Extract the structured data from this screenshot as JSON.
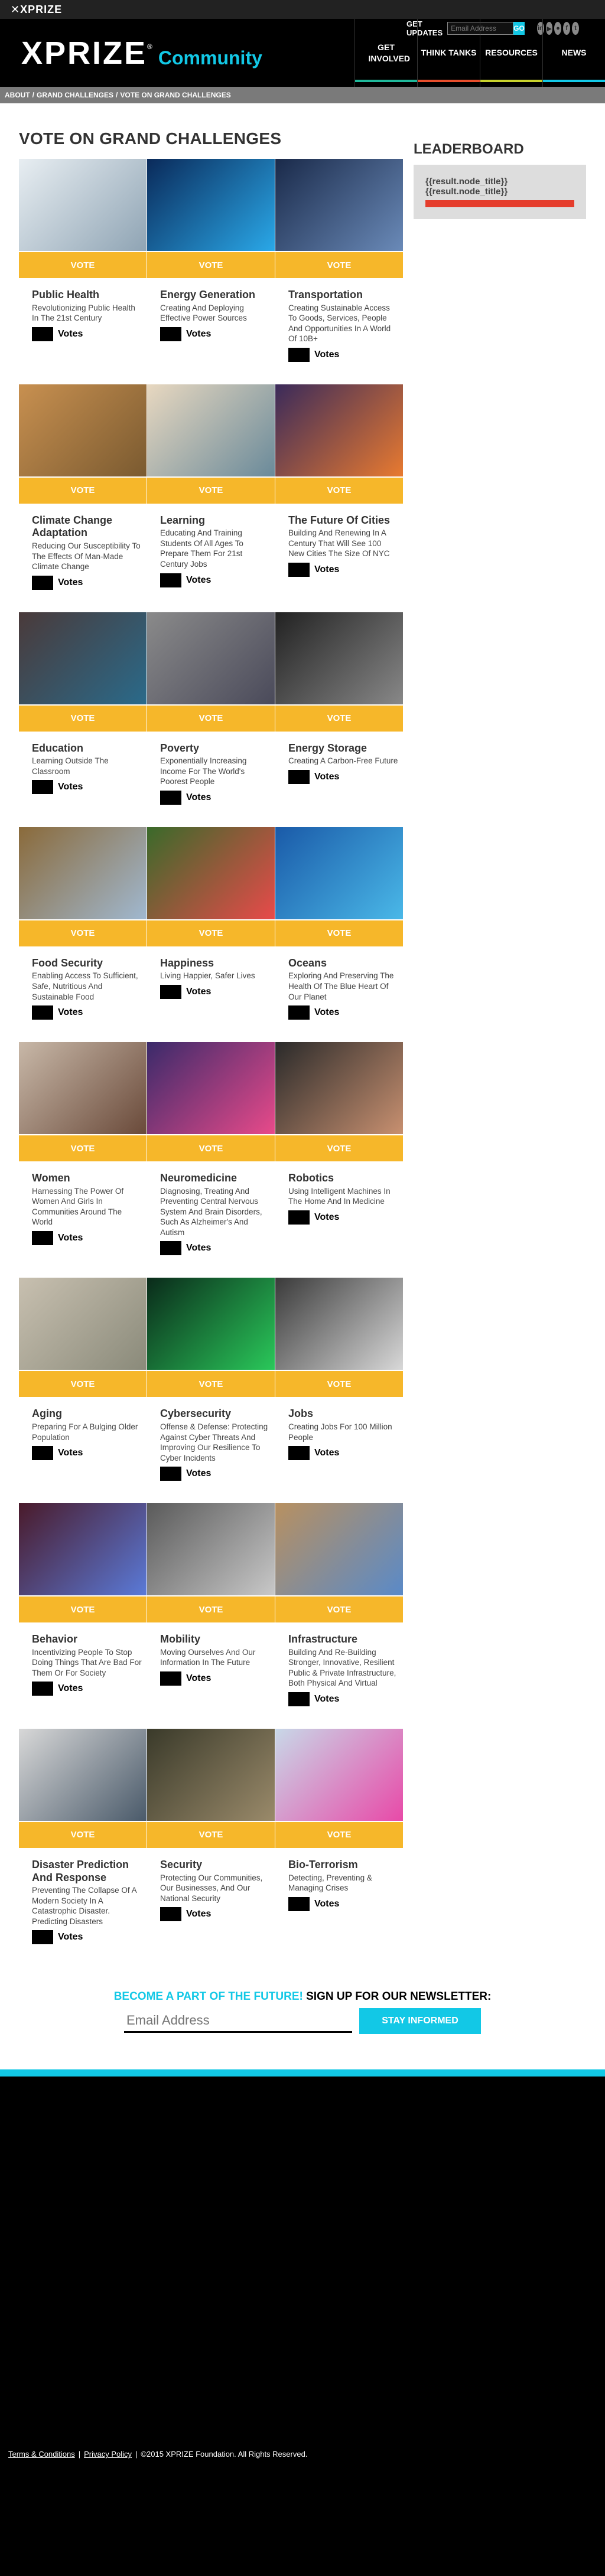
{
  "topbar": {
    "brand": "XPRIZE",
    "updates_label": "GET UPDATES",
    "email_placeholder": "Email Address",
    "go_label": "GO",
    "social": [
      "in",
      "▶",
      "●",
      "f",
      "t"
    ]
  },
  "header": {
    "logo": "XPRIZE",
    "tm": "®",
    "community": "Community",
    "nav": [
      "GET INVOLVED",
      "THINK TANKS",
      "RESOURCES",
      "NEWS"
    ]
  },
  "breadcrumb": [
    "ABOUT",
    "/",
    "GRAND CHALLENGES",
    "/",
    "VOTE ON GRAND CHALLENGES"
  ],
  "page_title": "VOTE ON GRAND CHALLENGES",
  "vote_label": "VOTE",
  "votes_label": "Votes",
  "challenges": [
    {
      "title": "Public Health",
      "desc": "revolutionizing public health in the 21st century"
    },
    {
      "title": "Energy Generation",
      "desc": "creating and deploying effective power sources"
    },
    {
      "title": "Transportation",
      "desc": "creating sustainable access to goods, services, people and opportunities in a world of 10B+"
    },
    {
      "title": "Climate Change Adaptation",
      "desc": "reducing our susceptibility to the effects of man-made climate change"
    },
    {
      "title": "Learning",
      "desc": "educating and training students of all ages to prepare them for 21st century jobs"
    },
    {
      "title": "The Future Of Cities",
      "desc": "building and renewing in a century that will see 100 new cities the size of NYC"
    },
    {
      "title": "Education",
      "desc": "Learning outside the classroom"
    },
    {
      "title": "Poverty",
      "desc": "exponentially increasing income for the world's poorest people"
    },
    {
      "title": "Energy Storage",
      "desc": "creating a carbon-free future"
    },
    {
      "title": "Food Security",
      "desc": "enabling access to sufficient, safe, nutritious and sustainable food"
    },
    {
      "title": "Happiness",
      "desc": "Living happier, safer lives"
    },
    {
      "title": "Oceans",
      "desc": "exploring and preserving the health of the blue heart of our planet"
    },
    {
      "title": "Women",
      "desc": "harnessing the power of women and girls in communities around the world"
    },
    {
      "title": "Neuromedicine",
      "desc": "Diagnosing, treating and preventing central nervous system and brain disorders, such as Alzheimer's and Autism"
    },
    {
      "title": "Robotics",
      "desc": "using intelligent machines in the home and in medicine"
    },
    {
      "title": "Aging",
      "desc": "preparing for a bulging older population"
    },
    {
      "title": "Cybersecurity",
      "desc": "offense & defense: protecting against cyber threats and improving our resilience to cyber incidents"
    },
    {
      "title": "Jobs",
      "desc": "creating jobs for 100 million people"
    },
    {
      "title": "Behavior",
      "desc": "incentivizing people to stop doing things that are bad for them or for society"
    },
    {
      "title": "Mobility",
      "desc": "moving ourselves and our information in the future"
    },
    {
      "title": "Infrastructure",
      "desc": "building and re-building stronger, innovative, resilient public & private infrastructure, both physical and virtual"
    },
    {
      "title": "Disaster Prediction And Response",
      "desc": "preventing the collapse of a modern society in a catastrophic disaster. predicting disasters"
    },
    {
      "title": "Security",
      "desc": "protecting our communities, our businesses, and our national security"
    },
    {
      "title": "Bio-Terrorism",
      "desc": "detecting, preventing & managing crises"
    }
  ],
  "leaderboard": {
    "title": "LEADERBOARD",
    "items": [
      "{{result.node_title}}",
      "{{result.node_title}}"
    ]
  },
  "newsletter": {
    "lead": "BECOME A PART OF THE FUTURE!",
    "rest": " SIGN UP FOR OUR NEWSLETTER:",
    "placeholder": "Email Address",
    "button": "STAY INFORMED"
  },
  "footer": {
    "terms": "Terms & Conditions",
    "privacy": "Privacy Policy",
    "copyright": "©2015 XPRIZE Foundation. All Rights Reserved.",
    "sep": "|"
  }
}
